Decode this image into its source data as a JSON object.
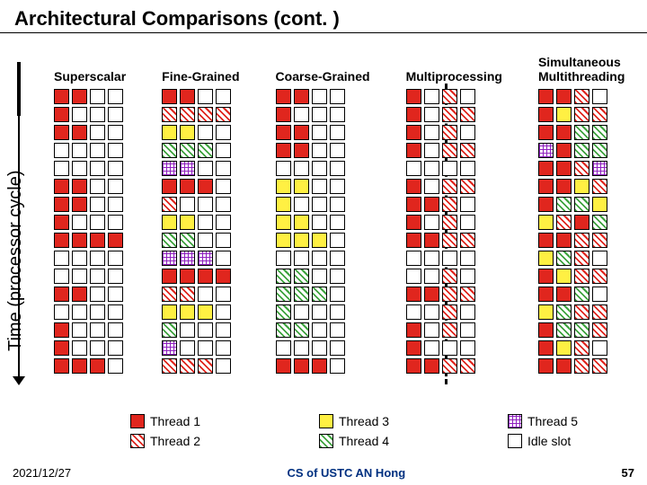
{
  "title": "Architectural Comparisons (cont. )",
  "y_axis": "Time (processor cycle)",
  "columns": [
    {
      "label": "Superscalar",
      "two_line": false
    },
    {
      "label": "Fine-Grained",
      "two_line": false
    },
    {
      "label": "Coarse-Grained",
      "two_line": false
    },
    {
      "label": "Multiprocessing",
      "two_line": false
    },
    {
      "label_line1": "Simultaneous",
      "label_line2": "Multithreading",
      "two_line": true
    }
  ],
  "legend": {
    "row1": [
      {
        "cls": "t1",
        "label": "Thread 1"
      },
      {
        "cls": "t3",
        "label": "Thread 3"
      },
      {
        "cls": "t5",
        "label": "Thread 5"
      }
    ],
    "row2": [
      {
        "cls": "t2",
        "label": "Thread 2"
      },
      {
        "cls": "t4",
        "label": "Thread 4"
      },
      {
        "cls": "idle",
        "label": "Idle slot"
      }
    ]
  },
  "footer": {
    "left": "2021/12/27",
    "center": "CS of USTC AN Hong",
    "right": "57"
  },
  "chart_data": {
    "type": "table",
    "note": "Each grid is 4 issue slots × 16 cycles. 0=idle, 1..5 = thread id.",
    "grids": {
      "Superscalar": [
        [
          1,
          1,
          0,
          0
        ],
        [
          1,
          0,
          0,
          0
        ],
        [
          1,
          1,
          0,
          0
        ],
        [
          0,
          0,
          0,
          0
        ],
        [
          0,
          0,
          0,
          0
        ],
        [
          1,
          1,
          0,
          0
        ],
        [
          1,
          1,
          0,
          0
        ],
        [
          1,
          0,
          0,
          0
        ],
        [
          1,
          1,
          1,
          1
        ],
        [
          0,
          0,
          0,
          0
        ],
        [
          0,
          0,
          0,
          0
        ],
        [
          1,
          1,
          0,
          0
        ],
        [
          0,
          0,
          0,
          0
        ],
        [
          1,
          0,
          0,
          0
        ],
        [
          1,
          0,
          0,
          0
        ],
        [
          1,
          1,
          1,
          0
        ]
      ],
      "Fine-Grained": [
        [
          1,
          1,
          0,
          0
        ],
        [
          2,
          2,
          2,
          2
        ],
        [
          3,
          3,
          0,
          0
        ],
        [
          4,
          4,
          4,
          0
        ],
        [
          5,
          5,
          0,
          0
        ],
        [
          1,
          1,
          1,
          0
        ],
        [
          2,
          0,
          0,
          0
        ],
        [
          3,
          3,
          0,
          0
        ],
        [
          4,
          4,
          0,
          0
        ],
        [
          5,
          5,
          5,
          0
        ],
        [
          1,
          1,
          1,
          1
        ],
        [
          2,
          2,
          0,
          0
        ],
        [
          3,
          3,
          3,
          0
        ],
        [
          4,
          0,
          0,
          0
        ],
        [
          5,
          0,
          0,
          0
        ],
        [
          2,
          2,
          2,
          0
        ]
      ],
      "Coarse-Grained": [
        [
          1,
          1,
          0,
          0
        ],
        [
          1,
          0,
          0,
          0
        ],
        [
          1,
          1,
          0,
          0
        ],
        [
          1,
          1,
          0,
          0
        ],
        [
          0,
          0,
          0,
          0
        ],
        [
          3,
          3,
          0,
          0
        ],
        [
          3,
          0,
          0,
          0
        ],
        [
          3,
          3,
          0,
          0
        ],
        [
          3,
          3,
          3,
          0
        ],
        [
          0,
          0,
          0,
          0
        ],
        [
          4,
          4,
          0,
          0
        ],
        [
          4,
          4,
          4,
          0
        ],
        [
          4,
          0,
          0,
          0
        ],
        [
          4,
          4,
          0,
          0
        ],
        [
          0,
          0,
          0,
          0
        ],
        [
          1,
          1,
          1,
          0
        ]
      ],
      "Multiprocessing": [
        [
          1,
          0,
          2,
          0
        ],
        [
          1,
          0,
          2,
          2
        ],
        [
          1,
          0,
          2,
          0
        ],
        [
          1,
          0,
          2,
          2
        ],
        [
          0,
          0,
          0,
          0
        ],
        [
          1,
          0,
          2,
          2
        ],
        [
          1,
          1,
          2,
          0
        ],
        [
          1,
          0,
          2,
          0
        ],
        [
          1,
          1,
          2,
          2
        ],
        [
          0,
          0,
          0,
          0
        ],
        [
          0,
          0,
          2,
          0
        ],
        [
          1,
          1,
          2,
          2
        ],
        [
          0,
          0,
          2,
          0
        ],
        [
          1,
          0,
          2,
          0
        ],
        [
          1,
          0,
          0,
          0
        ],
        [
          1,
          1,
          2,
          2
        ]
      ],
      "Simultaneous Multithreading": [
        [
          1,
          1,
          2,
          0
        ],
        [
          1,
          3,
          2,
          2
        ],
        [
          1,
          1,
          4,
          4
        ],
        [
          5,
          1,
          4,
          4
        ],
        [
          1,
          1,
          2,
          5
        ],
        [
          1,
          1,
          3,
          2
        ],
        [
          1,
          4,
          4,
          3
        ],
        [
          3,
          2,
          1,
          4
        ],
        [
          1,
          1,
          2,
          2
        ],
        [
          3,
          4,
          2,
          0
        ],
        [
          1,
          3,
          2,
          2
        ],
        [
          1,
          1,
          4,
          0
        ],
        [
          3,
          4,
          2,
          2
        ],
        [
          1,
          4,
          4,
          2
        ],
        [
          1,
          3,
          2,
          0
        ],
        [
          1,
          1,
          2,
          2
        ]
      ]
    }
  }
}
